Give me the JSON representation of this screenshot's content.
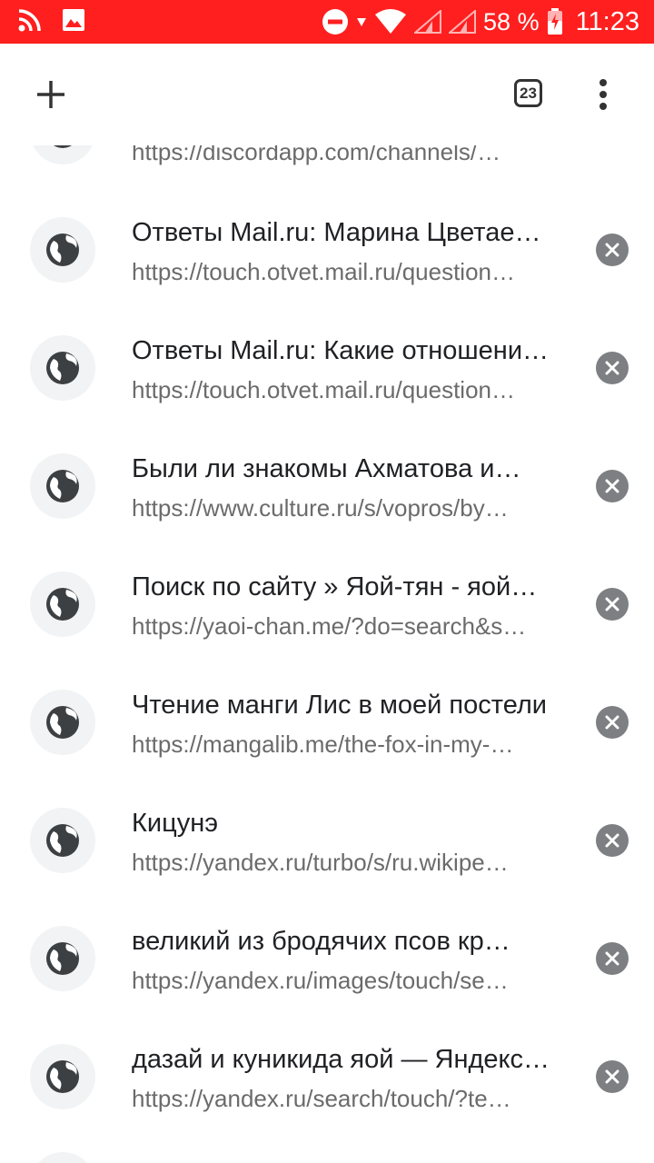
{
  "status_bar": {
    "battery_percent": "58 %",
    "time": "11:23",
    "color": "#ff1f1f"
  },
  "toolbar": {
    "new_tab_icon": "plus-icon",
    "tab_count": "23",
    "menu_icon": "more-vert-icon"
  },
  "tabs": [
    {
      "title": "",
      "url": "https://discordapp.com/channels/…"
    },
    {
      "title": "Ответы Mail.ru: Марина Цветаева…",
      "url": "https://touch.otvet.mail.ru/question…"
    },
    {
      "title": "Ответы Mail.ru: Какие отношения…",
      "url": "https://touch.otvet.mail.ru/question…"
    },
    {
      "title": "Были ли знакомы Ахматова и…",
      "url": "https://www.culture.ru/s/vopros/by…"
    },
    {
      "title": "Поиск по сайту » Яой-тян - яой…",
      "url": "https://yaoi-chan.me/?do=search&s…"
    },
    {
      "title": "Чтение манги Лис в моей постели",
      "url": "https://mangalib.me/the-fox-in-my-…"
    },
    {
      "title": "Кицунэ",
      "url": "https://yandex.ru/turbo/s/ru.wikipe…"
    },
    {
      "title": "великий из бродячих псов кр…",
      "url": "https://yandex.ru/images/touch/se…"
    },
    {
      "title": "дазай и куникида яой — Яндекс…",
      "url": "https://yandex.ru/search/touch/?te…"
    }
  ]
}
